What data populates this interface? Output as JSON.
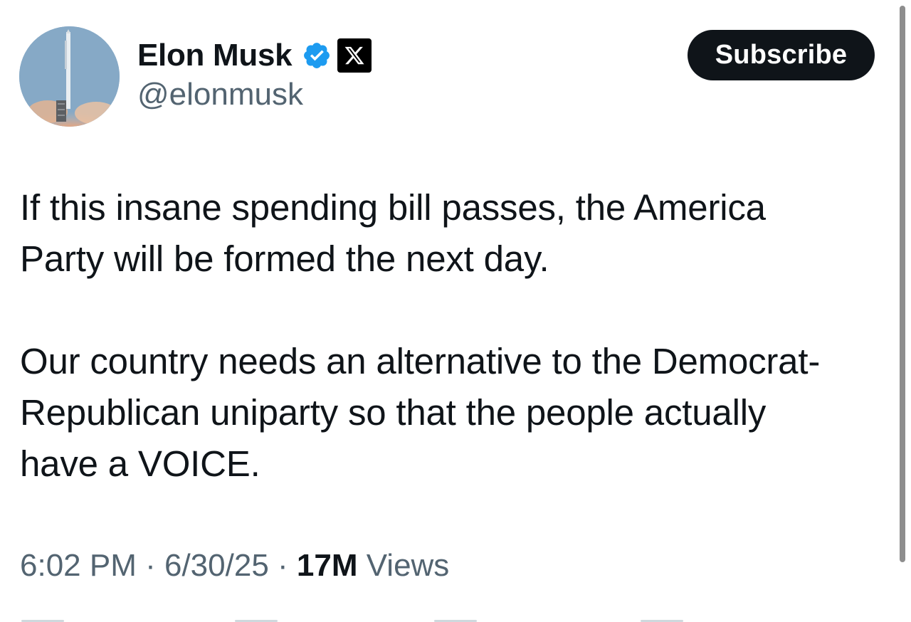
{
  "post": {
    "author": {
      "display_name": "Elon Musk",
      "handle": "@elonmusk",
      "verified_icon": "verified-badge-icon",
      "org_icon": "x-logo-icon",
      "avatar": "rocket-launch-avatar"
    },
    "subscribe_label": "Subscribe",
    "paragraphs": [
      "If this insane spending bill passes, the America\nParty will be formed the next day.",
      "Our country needs an alternative to the Democrat-\nRepublican uniparty so that the people actually\nhave a VOICE."
    ],
    "meta": {
      "time": "6:02 PM",
      "separator": " · ",
      "date": "6/30/25",
      "views_count": "17M",
      "views_label": "Views"
    }
  },
  "colors": {
    "text_primary": "#0f1419",
    "text_secondary": "#536471",
    "verified_blue": "#1d9bf0",
    "button_bg": "#0f1419"
  }
}
